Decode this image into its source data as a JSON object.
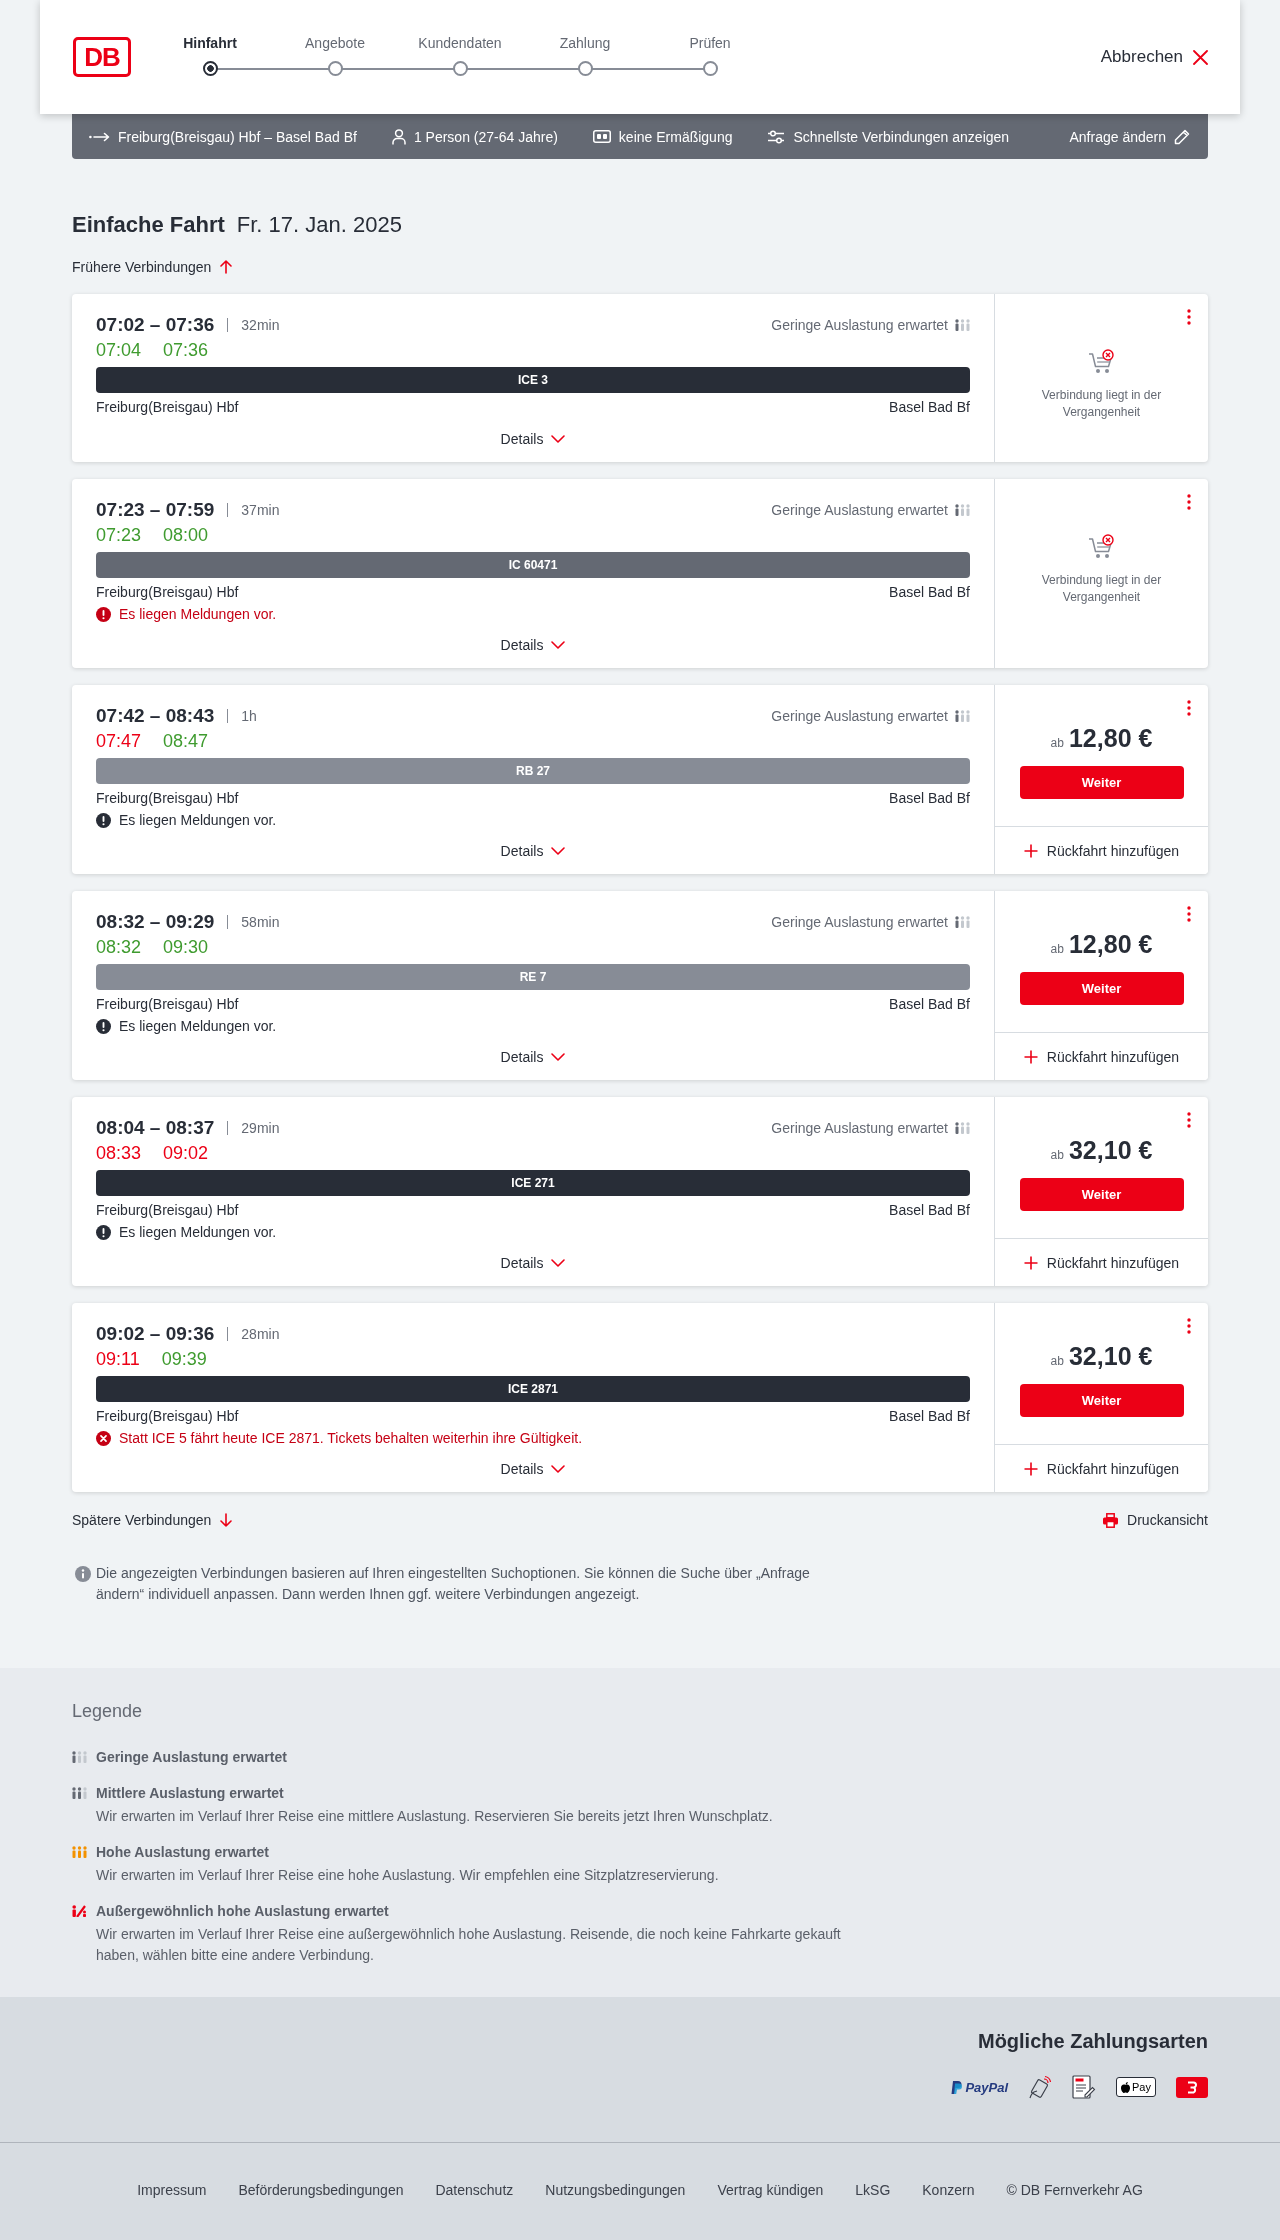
{
  "header": {
    "logo": "DB",
    "steps": [
      {
        "label": "Hinfahrt",
        "selected": true
      },
      {
        "label": "Angebote",
        "selected": false
      },
      {
        "label": "Kundendaten",
        "selected": false
      },
      {
        "label": "Zahlung",
        "selected": false
      },
      {
        "label": "Prüfen",
        "selected": false
      }
    ],
    "cancel": "Abbrechen"
  },
  "search_summary": {
    "route": "Freiburg(Breisgau) Hbf – Basel Bad Bf",
    "passengers": "1 Person (27-64 Jahre)",
    "discount": "keine Ermäßigung",
    "filter": "Schnellste Verbindungen anzeigen",
    "edit": "Anfrage ändern"
  },
  "heading": {
    "trip_type": "Einfache Fahrt",
    "date": "Fr. 17. Jan. 2025"
  },
  "earlier_link": "Frühere Verbindungen",
  "connections": [
    {
      "times": "07:02 – 07:36",
      "duration": "32min",
      "occupancy": {
        "kind": "low",
        "text": "Geringe Auslastung erwartet"
      },
      "realtime": [
        {
          "time": "07:04",
          "delayed": false
        },
        {
          "time": "07:36",
          "delayed": false
        }
      ],
      "train": {
        "kind": "ice",
        "name": "ICE 3"
      },
      "from": "Freiburg(Breisgau) Hbf",
      "to": "Basel Bad Bf",
      "details": "Details",
      "offer": {
        "kind": "past",
        "text": "Verbindung liegt in der Vergangenheit"
      }
    },
    {
      "times": "07:23 – 07:59",
      "duration": "37min",
      "occupancy": {
        "kind": "low",
        "text": "Geringe Auslastung erwartet"
      },
      "realtime": [
        {
          "time": "07:23",
          "delayed": false
        },
        {
          "time": "08:00",
          "delayed": false
        }
      ],
      "train": {
        "kind": "ic",
        "name": "IC 60471"
      },
      "from": "Freiburg(Breisgau) Hbf",
      "to": "Basel Bad Bf",
      "message": {
        "kind": "alert",
        "text": "Es liegen Meldungen vor."
      },
      "details": "Details",
      "offer": {
        "kind": "past",
        "text": "Verbindung liegt in der Vergangenheit"
      }
    },
    {
      "times": "07:42 – 08:43",
      "duration": "1h",
      "occupancy": {
        "kind": "low",
        "text": "Geringe Auslastung erwartet"
      },
      "realtime": [
        {
          "time": "07:47",
          "delayed": true
        },
        {
          "time": "08:47",
          "delayed": false
        }
      ],
      "train": {
        "kind": "regional",
        "name": "RB 27"
      },
      "from": "Freiburg(Breisgau) Hbf",
      "to": "Basel Bad Bf",
      "message": {
        "kind": "notice",
        "text": "Es liegen Meldungen vor."
      },
      "details": "Details",
      "offer": {
        "kind": "price",
        "prefix": "ab",
        "price": "12,80 €",
        "button": "Weiter",
        "return_link": "Rückfahrt hinzufügen"
      }
    },
    {
      "times": "08:32 – 09:29",
      "duration": "58min",
      "occupancy": {
        "kind": "low",
        "text": "Geringe Auslastung erwartet"
      },
      "realtime": [
        {
          "time": "08:32",
          "delayed": false
        },
        {
          "time": "09:30",
          "delayed": false
        }
      ],
      "train": {
        "kind": "regional",
        "name": "RE 7"
      },
      "from": "Freiburg(Breisgau) Hbf",
      "to": "Basel Bad Bf",
      "message": {
        "kind": "notice",
        "text": "Es liegen Meldungen vor."
      },
      "details": "Details",
      "offer": {
        "kind": "price",
        "prefix": "ab",
        "price": "12,80 €",
        "button": "Weiter",
        "return_link": "Rückfahrt hinzufügen"
      }
    },
    {
      "times": "08:04 – 08:37",
      "duration": "29min",
      "occupancy": {
        "kind": "low",
        "text": "Geringe Auslastung erwartet"
      },
      "realtime": [
        {
          "time": "08:33",
          "delayed": true
        },
        {
          "time": "09:02",
          "delayed": true
        }
      ],
      "train": {
        "kind": "ice",
        "name": "ICE 271"
      },
      "from": "Freiburg(Breisgau) Hbf",
      "to": "Basel Bad Bf",
      "message": {
        "kind": "notice",
        "text": "Es liegen Meldungen vor."
      },
      "details": "Details",
      "offer": {
        "kind": "price",
        "prefix": "ab",
        "price": "32,10 €",
        "button": "Weiter",
        "return_link": "Rückfahrt hinzufügen"
      }
    },
    {
      "times": "09:02 – 09:36",
      "duration": "28min",
      "realtime": [
        {
          "time": "09:11",
          "delayed": true
        },
        {
          "time": "09:39",
          "delayed": false
        }
      ],
      "train": {
        "kind": "ice",
        "name": "ICE 2871"
      },
      "from": "Freiburg(Breisgau) Hbf",
      "to": "Basel Bad Bf",
      "message": {
        "kind": "change",
        "text": "Statt ICE 5 fährt heute ICE 2871. Tickets behalten weiterhin ihre Gültigkeit."
      },
      "details": "Details",
      "offer": {
        "kind": "price",
        "prefix": "ab",
        "price": "32,10 €",
        "button": "Weiter",
        "return_link": "Rückfahrt hinzufügen"
      }
    }
  ],
  "later_link": "Spätere Verbindungen",
  "print_link": "Druckansicht",
  "note": "Die angezeigten Verbindungen basieren auf Ihren eingestellten Suchoptionen. Sie können die Suche über „Anfrage ändern“ individuell anpassen. Dann werden Ihnen ggf. weitere Verbindungen angezeigt.",
  "legend": {
    "title": "Legende",
    "items": [
      {
        "kind": "low",
        "title": "Geringe Auslastung erwartet"
      },
      {
        "kind": "medium",
        "title": "Mittlere Auslastung erwartet",
        "description": "Wir erwarten im Verlauf Ihrer Reise eine mittlere Auslastung. Reservieren Sie bereits jetzt Ihren Wunschplatz."
      },
      {
        "kind": "high",
        "title": "Hohe Auslastung erwartet",
        "description": "Wir erwarten im Verlauf Ihrer Reise eine hohe Auslastung. Wir empfehlen eine Sitzplatzreservierung."
      },
      {
        "kind": "extreme",
        "title": "Außergewöhnlich hohe Auslastung erwartet",
        "description": "Wir erwarten im Verlauf Ihrer Reise eine außergewöhnlich hohe Auslastung. Reisende, die noch keine Fahrkarte gekauft haben, wählen bitte eine andere Verbindung."
      }
    ]
  },
  "payment": {
    "title": "Mögliche Zahlungsarten",
    "methods": [
      {
        "kind": "paypal",
        "label": "PayPal"
      },
      {
        "kind": "contactless"
      },
      {
        "kind": "sepa"
      },
      {
        "kind": "applepay",
        "label": "Pay"
      },
      {
        "kind": "bonus"
      }
    ]
  },
  "footer_links": [
    "Impressum",
    "Beförderungsbedingungen",
    "Datenschutz",
    "Nutzungsbedingungen",
    "Vertrag kündigen",
    "LkSG",
    "Konzern",
    "© DB Fernverkehr AG"
  ]
}
